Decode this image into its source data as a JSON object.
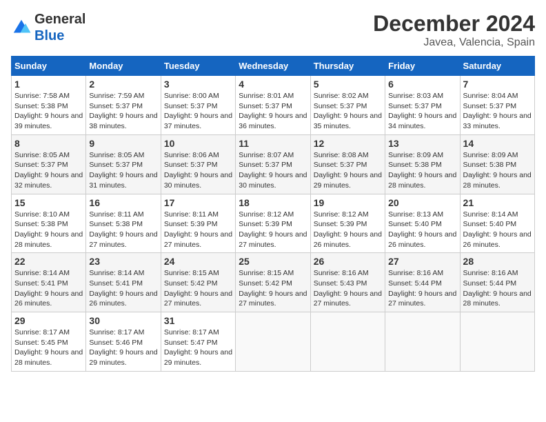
{
  "logo": {
    "line1": "General",
    "line2": "Blue"
  },
  "title": "December 2024",
  "subtitle": "Javea, Valencia, Spain",
  "days_header": [
    "Sunday",
    "Monday",
    "Tuesday",
    "Wednesday",
    "Thursday",
    "Friday",
    "Saturday"
  ],
  "weeks": [
    [
      {
        "day": "1",
        "sunrise": "7:58 AM",
        "sunset": "5:38 PM",
        "daylight": "9 hours and 39 minutes."
      },
      {
        "day": "2",
        "sunrise": "7:59 AM",
        "sunset": "5:37 PM",
        "daylight": "9 hours and 38 minutes."
      },
      {
        "day": "3",
        "sunrise": "8:00 AM",
        "sunset": "5:37 PM",
        "daylight": "9 hours and 37 minutes."
      },
      {
        "day": "4",
        "sunrise": "8:01 AM",
        "sunset": "5:37 PM",
        "daylight": "9 hours and 36 minutes."
      },
      {
        "day": "5",
        "sunrise": "8:02 AM",
        "sunset": "5:37 PM",
        "daylight": "9 hours and 35 minutes."
      },
      {
        "day": "6",
        "sunrise": "8:03 AM",
        "sunset": "5:37 PM",
        "daylight": "9 hours and 34 minutes."
      },
      {
        "day": "7",
        "sunrise": "8:04 AM",
        "sunset": "5:37 PM",
        "daylight": "9 hours and 33 minutes."
      }
    ],
    [
      {
        "day": "8",
        "sunrise": "8:05 AM",
        "sunset": "5:37 PM",
        "daylight": "9 hours and 32 minutes."
      },
      {
        "day": "9",
        "sunrise": "8:05 AM",
        "sunset": "5:37 PM",
        "daylight": "9 hours and 31 minutes."
      },
      {
        "day": "10",
        "sunrise": "8:06 AM",
        "sunset": "5:37 PM",
        "daylight": "9 hours and 30 minutes."
      },
      {
        "day": "11",
        "sunrise": "8:07 AM",
        "sunset": "5:37 PM",
        "daylight": "9 hours and 30 minutes."
      },
      {
        "day": "12",
        "sunrise": "8:08 AM",
        "sunset": "5:37 PM",
        "daylight": "9 hours and 29 minutes."
      },
      {
        "day": "13",
        "sunrise": "8:09 AM",
        "sunset": "5:38 PM",
        "daylight": "9 hours and 28 minutes."
      },
      {
        "day": "14",
        "sunrise": "8:09 AM",
        "sunset": "5:38 PM",
        "daylight": "9 hours and 28 minutes."
      }
    ],
    [
      {
        "day": "15",
        "sunrise": "8:10 AM",
        "sunset": "5:38 PM",
        "daylight": "9 hours and 28 minutes."
      },
      {
        "day": "16",
        "sunrise": "8:11 AM",
        "sunset": "5:38 PM",
        "daylight": "9 hours and 27 minutes."
      },
      {
        "day": "17",
        "sunrise": "8:11 AM",
        "sunset": "5:39 PM",
        "daylight": "9 hours and 27 minutes."
      },
      {
        "day": "18",
        "sunrise": "8:12 AM",
        "sunset": "5:39 PM",
        "daylight": "9 hours and 27 minutes."
      },
      {
        "day": "19",
        "sunrise": "8:12 AM",
        "sunset": "5:39 PM",
        "daylight": "9 hours and 26 minutes."
      },
      {
        "day": "20",
        "sunrise": "8:13 AM",
        "sunset": "5:40 PM",
        "daylight": "9 hours and 26 minutes."
      },
      {
        "day": "21",
        "sunrise": "8:14 AM",
        "sunset": "5:40 PM",
        "daylight": "9 hours and 26 minutes."
      }
    ],
    [
      {
        "day": "22",
        "sunrise": "8:14 AM",
        "sunset": "5:41 PM",
        "daylight": "9 hours and 26 minutes."
      },
      {
        "day": "23",
        "sunrise": "8:14 AM",
        "sunset": "5:41 PM",
        "daylight": "9 hours and 26 minutes."
      },
      {
        "day": "24",
        "sunrise": "8:15 AM",
        "sunset": "5:42 PM",
        "daylight": "9 hours and 27 minutes."
      },
      {
        "day": "25",
        "sunrise": "8:15 AM",
        "sunset": "5:42 PM",
        "daylight": "9 hours and 27 minutes."
      },
      {
        "day": "26",
        "sunrise": "8:16 AM",
        "sunset": "5:43 PM",
        "daylight": "9 hours and 27 minutes."
      },
      {
        "day": "27",
        "sunrise": "8:16 AM",
        "sunset": "5:44 PM",
        "daylight": "9 hours and 27 minutes."
      },
      {
        "day": "28",
        "sunrise": "8:16 AM",
        "sunset": "5:44 PM",
        "daylight": "9 hours and 28 minutes."
      }
    ],
    [
      {
        "day": "29",
        "sunrise": "8:17 AM",
        "sunset": "5:45 PM",
        "daylight": "9 hours and 28 minutes."
      },
      {
        "day": "30",
        "sunrise": "8:17 AM",
        "sunset": "5:46 PM",
        "daylight": "9 hours and 29 minutes."
      },
      {
        "day": "31",
        "sunrise": "8:17 AM",
        "sunset": "5:47 PM",
        "daylight": "9 hours and 29 minutes."
      },
      null,
      null,
      null,
      null
    ]
  ]
}
